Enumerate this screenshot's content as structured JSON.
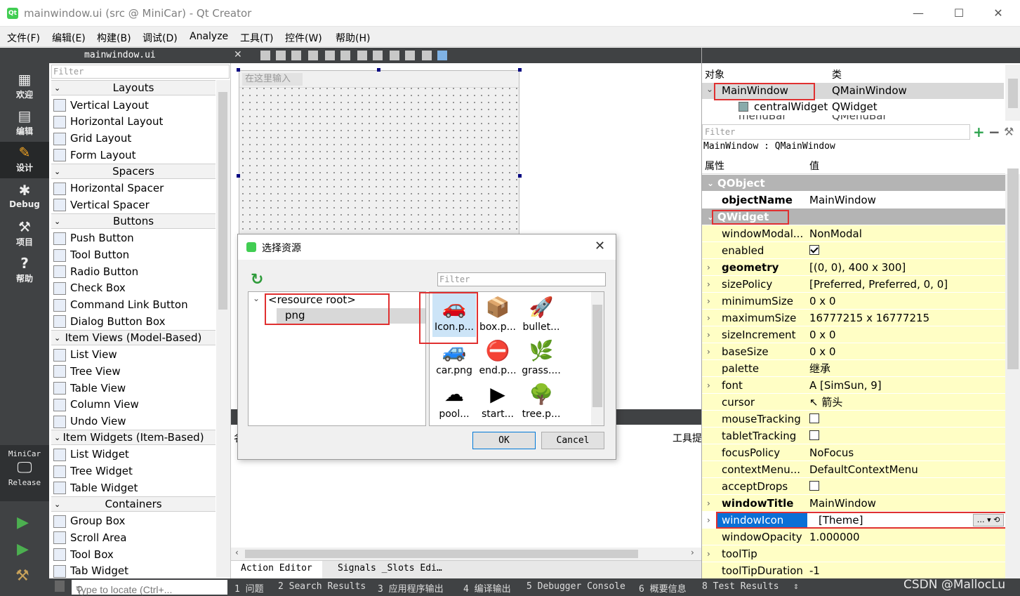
{
  "window": {
    "title": "mainwindow.ui (src @ MiniCar) - Qt Creator",
    "icon": "qt-creator-icon",
    "minimize": "—",
    "maximize": "☐",
    "close": "✕"
  },
  "menubar": [
    "文件(F)",
    "编辑(E)",
    "构建(B)",
    "调试(D)",
    "Analyze",
    "工具(T)",
    "控件(W)",
    "帮助(H)"
  ],
  "modes": {
    "welcome": "欢迎",
    "edit": "编辑",
    "design": "设计",
    "debug": "Debug",
    "projects": "项目",
    "help": "帮助",
    "kit_project": "MiniCar",
    "kit_config": "Release"
  },
  "widgetbox": {
    "file": "mainwindow.ui",
    "filter": "Filter",
    "rows": [
      {
        "type": "cat",
        "label": "Layouts"
      },
      {
        "type": "item",
        "label": "Vertical Layout"
      },
      {
        "type": "item",
        "label": "Horizontal Layout"
      },
      {
        "type": "item",
        "label": "Grid Layout"
      },
      {
        "type": "item",
        "label": "Form Layout"
      },
      {
        "type": "cat",
        "label": "Spacers"
      },
      {
        "type": "item",
        "label": "Horizontal Spacer"
      },
      {
        "type": "item",
        "label": "Vertical Spacer"
      },
      {
        "type": "cat",
        "label": "Buttons"
      },
      {
        "type": "item",
        "label": "Push Button"
      },
      {
        "type": "item",
        "label": "Tool Button"
      },
      {
        "type": "item",
        "label": "Radio Button"
      },
      {
        "type": "item",
        "label": "Check Box"
      },
      {
        "type": "item",
        "label": "Command Link Button"
      },
      {
        "type": "item",
        "label": "Dialog Button Box"
      },
      {
        "type": "cat",
        "label": "Item Views (Model-Based)"
      },
      {
        "type": "item",
        "label": "List View"
      },
      {
        "type": "item",
        "label": "Tree View"
      },
      {
        "type": "item",
        "label": "Table View"
      },
      {
        "type": "item",
        "label": "Column View"
      },
      {
        "type": "item",
        "label": "Undo View"
      },
      {
        "type": "cat",
        "label": "Item Widgets (Item-Based)"
      },
      {
        "type": "item",
        "label": "List Widget"
      },
      {
        "type": "item",
        "label": "Tree Widget"
      },
      {
        "type": "item",
        "label": "Table Widget"
      },
      {
        "type": "cat",
        "label": "Containers"
      },
      {
        "type": "item",
        "label": "Group Box"
      },
      {
        "type": "item",
        "label": "Scroll Area"
      },
      {
        "type": "item",
        "label": "Tool Box"
      },
      {
        "type": "item",
        "label": "Tab Widget"
      }
    ]
  },
  "form": {
    "menu_placeholder": "在这里输入",
    "partial_label_left": "名",
    "partial_label_right": "工具提"
  },
  "bottom_tabs": {
    "action_editor": "Action Editor",
    "signals_slots": "Signals _Slots Edi…"
  },
  "object_inspector": {
    "col_object": "对象",
    "col_class": "类",
    "rows": [
      {
        "name": "MainWindow",
        "cls": "QMainWindow"
      },
      {
        "name": "centralWidget",
        "cls": "QWidget"
      },
      {
        "name": "menuBar",
        "cls": "QMenuBar"
      }
    ]
  },
  "property_editor": {
    "filter": "Filter",
    "class_line": "MainWindow : QMainWindow",
    "col_property": "属性",
    "col_value": "值",
    "rows": [
      {
        "kind": "group",
        "name": "QObject"
      },
      {
        "kind": "prop",
        "name": "objectName",
        "value": "MainWindow",
        "bold": true,
        "expand": false,
        "y": false
      },
      {
        "kind": "group",
        "name": "QWidget"
      },
      {
        "kind": "prop",
        "name": "windowModal...",
        "value": "NonModal",
        "y": true
      },
      {
        "kind": "check",
        "name": "enabled",
        "checked": true,
        "y": true
      },
      {
        "kind": "prop",
        "name": "geometry",
        "value": "[(0, 0), 400 x 300]",
        "bold": true,
        "expand": true,
        "y": true
      },
      {
        "kind": "prop",
        "name": "sizePolicy",
        "value": "[Preferred, Preferred, 0, 0]",
        "expand": true,
        "y": true
      },
      {
        "kind": "prop",
        "name": "minimumSize",
        "value": "0 x 0",
        "expand": true,
        "y": true
      },
      {
        "kind": "prop",
        "name": "maximumSize",
        "value": "16777215 x 16777215",
        "expand": true,
        "y": true
      },
      {
        "kind": "prop",
        "name": "sizeIncrement",
        "value": "0 x 0",
        "expand": true,
        "y": true
      },
      {
        "kind": "prop",
        "name": "baseSize",
        "value": "0 x 0",
        "expand": true,
        "y": true
      },
      {
        "kind": "prop",
        "name": "palette",
        "value": "继承",
        "y": true
      },
      {
        "kind": "prop",
        "name": "font",
        "value": "A  [SimSun, 9]",
        "expand": true,
        "y": true
      },
      {
        "kind": "prop",
        "name": "cursor",
        "value": "↖  箭头",
        "y": true
      },
      {
        "kind": "check",
        "name": "mouseTracking",
        "checked": false,
        "y": true
      },
      {
        "kind": "check",
        "name": "tabletTracking",
        "checked": false,
        "y": true
      },
      {
        "kind": "prop",
        "name": "focusPolicy",
        "value": "NoFocus",
        "y": true
      },
      {
        "kind": "prop",
        "name": "contextMenu...",
        "value": "DefaultContextMenu",
        "y": true
      },
      {
        "kind": "check",
        "name": "acceptDrops",
        "checked": false,
        "y": true
      },
      {
        "kind": "prop",
        "name": "windowTitle",
        "value": "MainWindow",
        "bold": true,
        "expand": true,
        "y": true
      },
      {
        "kind": "selected",
        "name": "windowIcon",
        "value": "[Theme]",
        "expand": true
      },
      {
        "kind": "prop",
        "name": "windowOpacity",
        "value": "1.000000",
        "y": true
      },
      {
        "kind": "prop",
        "name": "toolTip",
        "value": "",
        "expand": true,
        "y": true
      },
      {
        "kind": "prop",
        "name": "toolTipDuration",
        "value": "-1",
        "y": true
      }
    ]
  },
  "dialog": {
    "title": "选择资源",
    "filter_placeholder": "Filter",
    "tree_root": "<resource root>",
    "tree_child": "png",
    "icons": [
      {
        "label": "Icon.p...",
        "icon": "car-sports-icon",
        "glyph": "🚗"
      },
      {
        "label": "box.p...",
        "icon": "box-icon",
        "glyph": "📦"
      },
      {
        "label": "bullet...",
        "icon": "rocket-icon",
        "glyph": "🚀"
      },
      {
        "label": "car.png",
        "icon": "car-top-icon",
        "glyph": "🚙"
      },
      {
        "label": "end.p...",
        "icon": "stop-sign-icon",
        "glyph": "⛔"
      },
      {
        "label": "grass....",
        "icon": "grass-icon",
        "glyph": "🌿"
      },
      {
        "label": "pool...",
        "icon": "cloud-icon",
        "glyph": "☁"
      },
      {
        "label": "start...",
        "icon": "play-triangle-icon",
        "glyph": "▶"
      },
      {
        "label": "tree.p...",
        "icon": "tree-icon",
        "glyph": "🌳"
      }
    ],
    "ok": "OK",
    "cancel": "Cancel"
  },
  "statusbar": {
    "locate_placeholder": "Type to locate (Ctrl+...",
    "panes": [
      "1 问题",
      "2 Search Results",
      "3 应用程序输出",
      "4 编译输出",
      "5 Debugger Console",
      "6 概要信息",
      "8 Test Results"
    ]
  },
  "watermark": "CSDN @MallocLu",
  "colors": {
    "modebar": "#404244",
    "selection": "#0a6fd6",
    "highlight_box": "#e03030",
    "property_yellow": "#fffec5",
    "group_gray": "#b4b4b4"
  }
}
